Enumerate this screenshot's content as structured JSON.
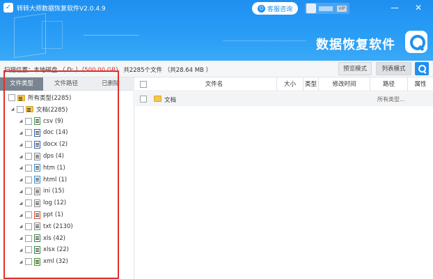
{
  "header": {
    "app_title": "转转大师数据恢复软件V2.0.4.9",
    "support_label": "客服咨询",
    "vip_label": "VIP",
    "minimize": "—",
    "close": "✕",
    "brand": "数据恢复软件"
  },
  "scan": {
    "prefix": "扫描位置：本地磁盘 （ D: ）（",
    "size": "500.00 GB",
    "suffix": "） 共2285个文件 （共28.64 MB ）",
    "preview_mode": "预览模式",
    "list_mode": "列表模式"
  },
  "tabs": [
    "文件类型",
    "文件路径",
    "已删除"
  ],
  "tree": [
    {
      "label": "所有类型(2285)",
      "icon": "folder",
      "level": 0
    },
    {
      "label": "文档(2285)",
      "icon": "folder",
      "level": 1
    },
    {
      "label": "csv (9)",
      "icon": "csv",
      "level": 2
    },
    {
      "label": "doc (14)",
      "icon": "doc",
      "level": 2
    },
    {
      "label": "docx (2)",
      "icon": "docx",
      "level": 2
    },
    {
      "label": "dps (4)",
      "icon": "dps",
      "level": 2
    },
    {
      "label": "htm (1)",
      "icon": "htm",
      "level": 2
    },
    {
      "label": "html (1)",
      "icon": "html",
      "level": 2
    },
    {
      "label": "ini (15)",
      "icon": "ini",
      "level": 2
    },
    {
      "label": "log (12)",
      "icon": "log",
      "level": 2
    },
    {
      "label": "ppt (1)",
      "icon": "ppt",
      "level": 2
    },
    {
      "label": "txt (2130)",
      "icon": "txt",
      "level": 2
    },
    {
      "label": "xls (42)",
      "icon": "xls",
      "level": 2
    },
    {
      "label": "xlsx (22)",
      "icon": "xlsx",
      "level": 2
    },
    {
      "label": "xml (32)",
      "icon": "xml",
      "level": 2
    }
  ],
  "table": {
    "columns": [
      "文件名",
      "大小",
      "类型",
      "修改时间",
      "路径",
      "属性"
    ],
    "rows": [
      {
        "name": "文档",
        "path": "所有类型..."
      }
    ]
  },
  "colors": {
    "accent": "#1f8ff0",
    "highlight": "#e0302b"
  }
}
